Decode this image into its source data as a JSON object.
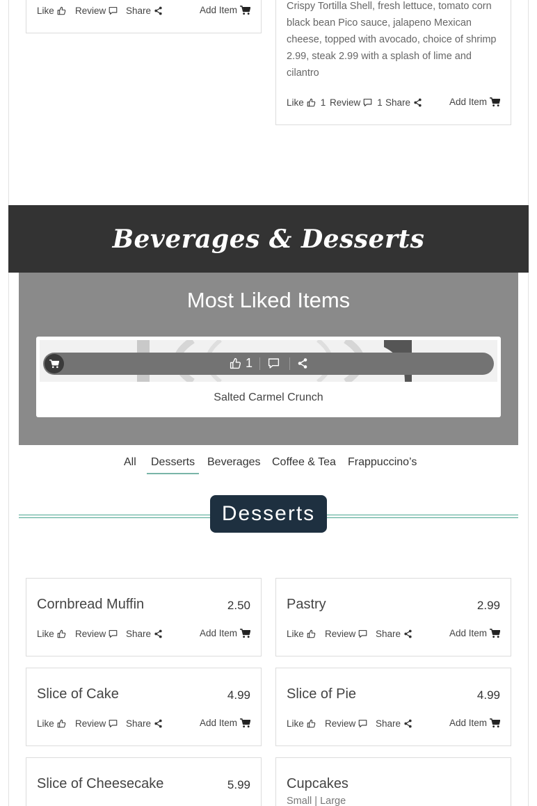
{
  "actions": {
    "like": "Like",
    "review": "Review",
    "share": "Share",
    "add_item": "Add Item"
  },
  "top_card": {
    "description": "Crispy Tortilla Shell, fresh lettuce, tomato corn black bean Pico sauce, jalapeno Mexican cheese, topped with avocado, choice of shrimp 2.99, steak 2.99 with a splash of lime and cilantro",
    "like_count": "1",
    "review_count": "1"
  },
  "section_banner": "Beverages & Desserts",
  "most_liked": {
    "title": "Most Liked Items",
    "item_name": "Salted Carmel Crunch",
    "like_count": "1"
  },
  "tabs": [
    "All",
    "Desserts",
    "Beverages",
    "Coffee & Tea",
    "Frappuccino’s"
  ],
  "active_tab": "Desserts",
  "section_title": "Desserts",
  "items": [
    {
      "name": "Cornbread Muffin",
      "price": "2.50"
    },
    {
      "name": "Pastry",
      "price": "2.99"
    },
    {
      "name": "Slice of Cake",
      "price": "4.99"
    },
    {
      "name": "Slice of Pie",
      "price": "4.99"
    },
    {
      "name": "Slice of Cheesecake",
      "price": "5.99"
    },
    {
      "name": "Cupcakes",
      "sizes": "Small | Large"
    }
  ],
  "colors": {
    "banner_bg": "#333333",
    "most_liked_bg": "#8a8a8a",
    "section_title_bg": "#1e3040",
    "accent_line": "#4aa590"
  }
}
